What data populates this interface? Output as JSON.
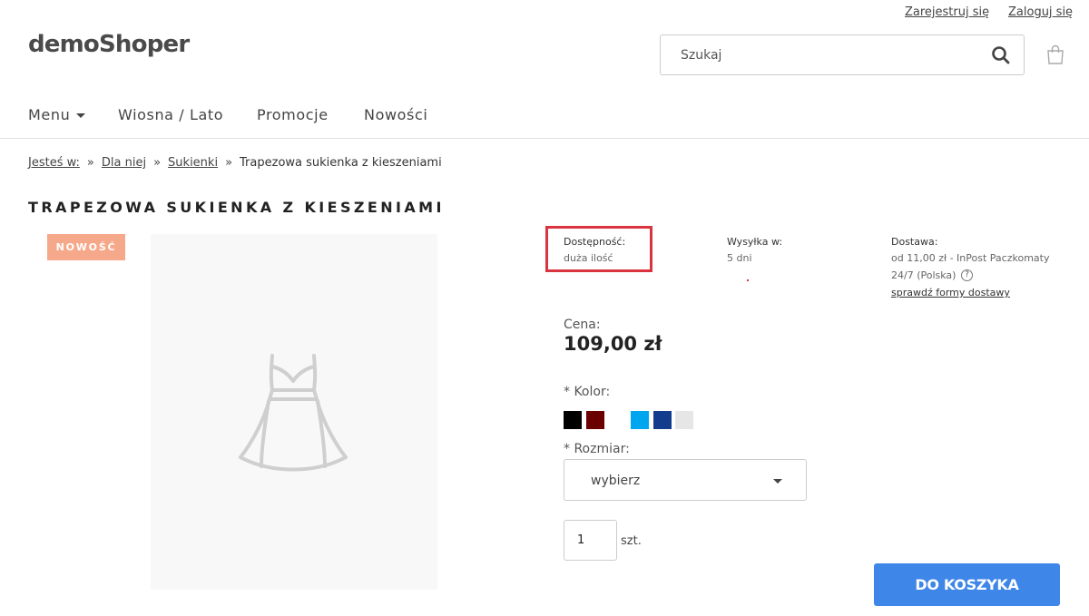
{
  "header": {
    "register_label": "Zarejestruj się",
    "login_label": "Zaloguj się",
    "logo": "demoShoper",
    "search_placeholder": "Szukaj"
  },
  "nav": {
    "menu_label": "Menu",
    "items": [
      "Wiosna / Lato",
      "Promocje",
      "Nowości"
    ]
  },
  "breadcrumb": {
    "prefix": "Jesteś w:",
    "items": [
      "Dla niej",
      "Sukienki"
    ],
    "current": "Trapezowa sukienka z kieszeniami"
  },
  "product": {
    "title": "TRAPEZOWA SUKIENKA Z KIESZENIAMI",
    "badge": "NOWOŚĆ",
    "availability_label": "Dostępność:",
    "availability_value": "duża ilość",
    "shipping_label": "Wysyłka w:",
    "shipping_value": "5 dni",
    "delivery_label": "Dostawa:",
    "delivery_value_line1": "od 11,00 zł - InPost Paczkomaty",
    "delivery_value_line2": "24/7 (Polska)",
    "delivery_link": "sprawdź formy dostawy",
    "price_label": "Cena:",
    "price": "109,00 zł",
    "color_label": "* Kolor:",
    "colors": [
      "#000000",
      "#6b0000",
      "#ffffff",
      "#00a5f0",
      "#143c8c",
      "#e6e6e6"
    ],
    "size_label": "* Rozmiar:",
    "size_selected": "wybierz",
    "quantity": "1",
    "quantity_unit": "szt.",
    "add_to_cart": "DO KOSZYKA"
  }
}
